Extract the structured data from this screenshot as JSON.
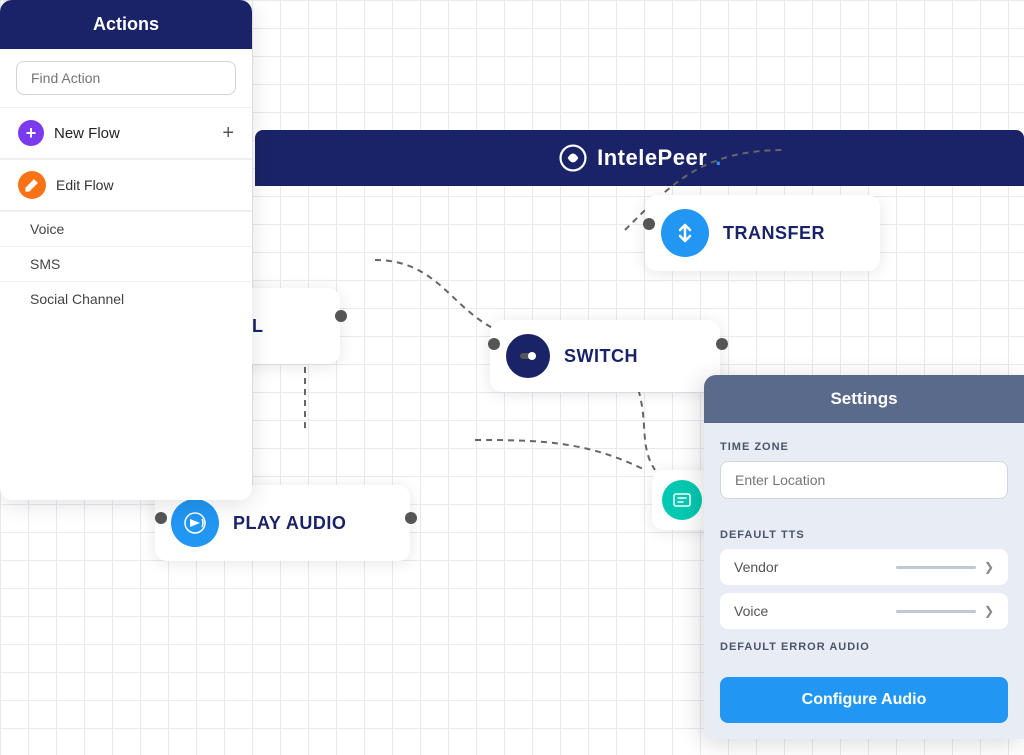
{
  "header": {
    "title": "IntelePeer",
    "logo_symbol": "℗"
  },
  "sidebar": {
    "title": "Actions",
    "search_placeholder": "Find Action",
    "new_flow_label": "New Flow",
    "new_flow_plus": "+",
    "edit_flow_label": "Edit Flow",
    "sub_items": [
      "Voice",
      "SMS",
      "Social Channel"
    ]
  },
  "nodes": [
    {
      "id": "icall",
      "label": "ICALL",
      "icon_type": "teal",
      "icon_unicode": "📞"
    },
    {
      "id": "playaudio",
      "label": "PLAY AUDIO",
      "icon_type": "blue",
      "icon_unicode": "🔊"
    },
    {
      "id": "switch",
      "label": "SWITCH",
      "icon_type": "toggle"
    },
    {
      "id": "transfer",
      "label": "TRANSFER",
      "icon_type": "blue",
      "icon_unicode": "⇅"
    }
  ],
  "settings": {
    "title": "Settings",
    "timezone_label": "TIME ZONE",
    "timezone_placeholder": "Enter Location",
    "tts_label": "DEFAULT TTS",
    "vendor_label": "Vendor",
    "voice_label": "Voice",
    "error_audio_label": "DEFAULT ERROR AUDIO",
    "configure_btn": "Configure Audio"
  }
}
